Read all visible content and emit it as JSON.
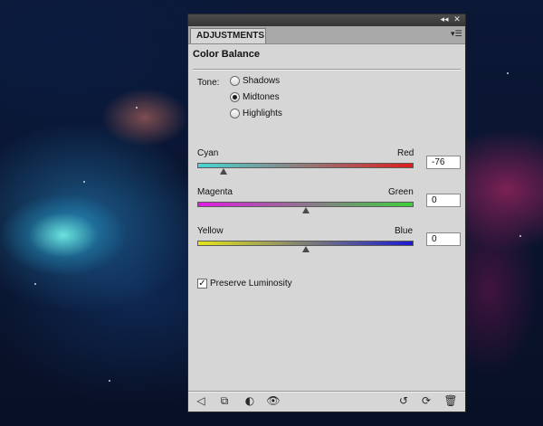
{
  "panel": {
    "tab_label": "ADJUSTMENTS",
    "title": "Color Balance",
    "topbar": {
      "collapse_glyph": "◂◂",
      "close_glyph": "✕"
    },
    "menu_glyph": "▾☰"
  },
  "tone": {
    "label": "Tone:",
    "options": [
      "Shadows",
      "Midtones",
      "Highlights"
    ],
    "selected": "Midtones"
  },
  "sliders": [
    {
      "left_label": "Cyan",
      "right_label": "Red",
      "value": "-76",
      "position_fraction": 0.12,
      "gradient": [
        "#46d6d6",
        "#e01c1c"
      ]
    },
    {
      "left_label": "Magenta",
      "right_label": "Green",
      "value": "0",
      "position_fraction": 0.5,
      "gradient": [
        "#e21ce2",
        "#3bd03b"
      ]
    },
    {
      "left_label": "Yellow",
      "right_label": "Blue",
      "value": "0",
      "position_fraction": 0.5,
      "gradient": [
        "#e4e41a",
        "#1a1ad2"
      ]
    }
  ],
  "preserve_luminosity": {
    "label": "Preserve Luminosity",
    "checked": true,
    "check_glyph": "✓"
  },
  "footer": {
    "icons": [
      {
        "name": "return-to-list-icon",
        "glyph": "◁"
      },
      {
        "name": "clip-to-layer-icon",
        "glyph": "⧉"
      },
      {
        "name": "view-previous-state-icon",
        "glyph": "◐"
      },
      {
        "name": "visibility-eye-icon",
        "glyph": "👁"
      },
      {
        "name": "reset-icon",
        "glyph": "↺"
      },
      {
        "name": "refresh-icon",
        "glyph": "⟳"
      },
      {
        "name": "trash-icon",
        "glyph": "🗑"
      }
    ]
  }
}
